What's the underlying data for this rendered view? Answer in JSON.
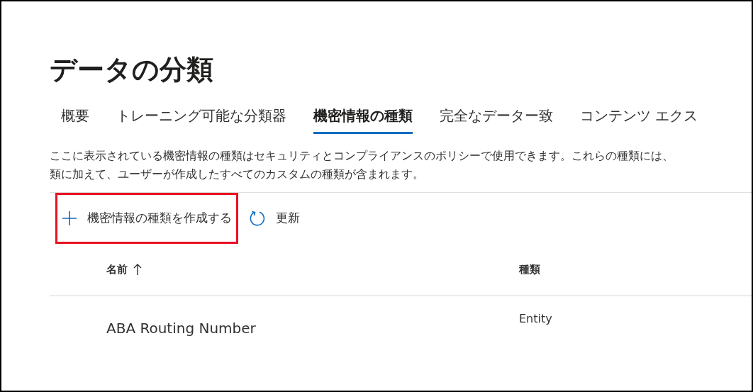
{
  "title": "データの分類",
  "tabs": [
    {
      "label": "概要",
      "selected": false
    },
    {
      "label": "トレーニング可能な分類器",
      "selected": false
    },
    {
      "label": "機密情報の種類",
      "selected": true
    },
    {
      "label": "完全なデーター致",
      "selected": false
    },
    {
      "label": "コンテンツ エクス",
      "selected": false
    }
  ],
  "description_lines": [
    "ここに表示されている機密情報の種類はセキュリティとコンプライアンスのポリシーで使用できます。これらの種類には、",
    "類に加えて、ユーザーが作成したすべてのカスタムの種類が含まれます。"
  ],
  "toolbar": [
    {
      "kind": "create",
      "label": "機密情報の種類を作成する",
      "highlighted": true
    },
    {
      "kind": "refresh",
      "label": "更新",
      "highlighted": false
    }
  ],
  "table": {
    "columns": [
      {
        "label": "名前",
        "sorted_ascending": true
      },
      {
        "label": "種類"
      }
    ],
    "rows": [
      [
        "ABA Routing Number",
        "Entity"
      ]
    ]
  }
}
